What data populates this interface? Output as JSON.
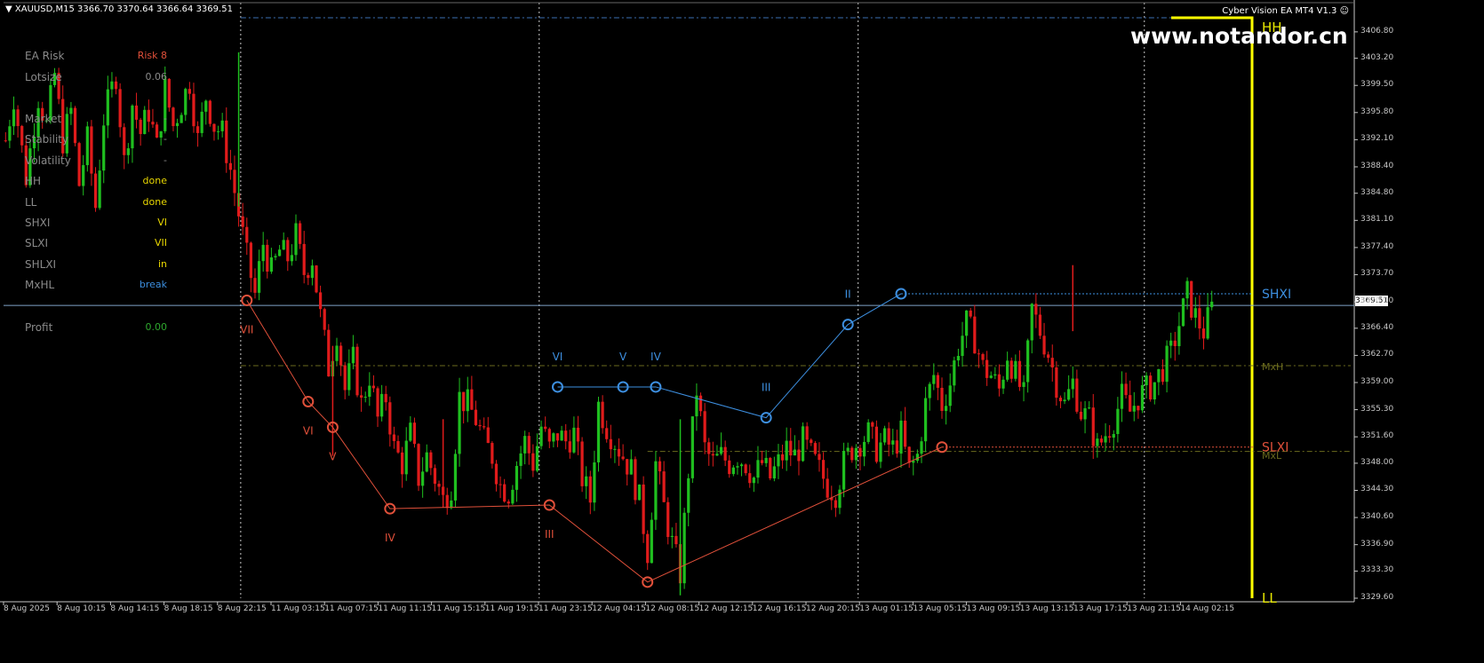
{
  "window": {
    "symbol_header": "XAUUSD,M15  3366.70 3370.64 3366.64 3369.51",
    "ea_title": "Cyber Vision EA MT4 V1.3",
    "watermark": "www.notandor.cn",
    "current_price": "3369.51"
  },
  "info_panel": [
    {
      "label": "EA Risk",
      "value": "Risk 8",
      "color": "#e0503a"
    },
    {
      "label": "Lotsize",
      "value": "0.06",
      "color": "#8a8a8a"
    },
    {
      "label": "Market",
      "value": "-",
      "color": "#8a8a8a"
    },
    {
      "label": "Stability",
      "value": "-",
      "color": "#8a8a8a"
    },
    {
      "label": "Volatility",
      "value": "-",
      "color": "#8a8a8a"
    },
    {
      "label": "HH",
      "value": "done",
      "color": "#e8d600"
    },
    {
      "label": "LL",
      "value": "done",
      "color": "#e8d600"
    },
    {
      "label": "SHXI",
      "value": "VI",
      "color": "#e8d600"
    },
    {
      "label": "SLXI",
      "value": "VII",
      "color": "#e8d600"
    },
    {
      "label": "SHLXI",
      "value": "in",
      "color": "#e8d600"
    },
    {
      "label": "MxHL",
      "value": "break",
      "color": "#3d8fe0"
    },
    {
      "label": "Profit",
      "value": "0.00",
      "color": "#2ea82e"
    }
  ],
  "chart_data": {
    "type": "candlestick",
    "symbol": "XAUUSD",
    "timeframe": "M15",
    "ylim": [
      3329.6,
      3408.6
    ],
    "price_ticks": [
      "3406.80",
      "3403.20",
      "3399.50",
      "3395.80",
      "3392.10",
      "3388.40",
      "3384.80",
      "3381.10",
      "3377.40",
      "3373.70",
      "3370.00",
      "3366.40",
      "3362.70",
      "3359.00",
      "3355.30",
      "3351.60",
      "3348.00",
      "3344.30",
      "3340.60",
      "3336.90",
      "3333.30",
      "3329.60"
    ],
    "time_ticks": [
      "8 Aug 2025",
      "8 Aug 10:15",
      "8 Aug 14:15",
      "8 Aug 18:15",
      "8 Aug 22:15",
      "11 Aug 03:15",
      "11 Aug 07:15",
      "11 Aug 11:15",
      "11 Aug 15:15",
      "11 Aug 19:15",
      "11 Aug 23:15",
      "12 Aug 04:15",
      "12 Aug 08:15",
      "12 Aug 12:15",
      "12 Aug 16:15",
      "12 Aug 20:15",
      "13 Aug 01:15",
      "13 Aug 05:15",
      "13 Aug 09:15",
      "13 Aug 13:15",
      "13 Aug 17:15",
      "13 Aug 21:15",
      "14 Aug 02:15"
    ],
    "price_anchors": [
      [
        0,
        3392
      ],
      [
        2,
        3398
      ],
      [
        5,
        3387
      ],
      [
        8,
        3398
      ],
      [
        10,
        3394
      ],
      [
        12,
        3401
      ],
      [
        14,
        3392
      ],
      [
        16,
        3396
      ],
      [
        18,
        3386
      ],
      [
        20,
        3392
      ],
      [
        22,
        3383
      ],
      [
        24,
        3395
      ],
      [
        27,
        3401
      ],
      [
        29,
        3389
      ],
      [
        31,
        3397
      ],
      [
        33,
        3393
      ],
      [
        35,
        3396
      ],
      [
        37,
        3391
      ],
      [
        39,
        3399
      ],
      [
        41,
        3394
      ],
      [
        43,
        3397
      ],
      [
        45,
        3400
      ],
      [
        47,
        3392
      ],
      [
        49,
        3398
      ],
      [
        51,
        3394
      ],
      [
        53,
        3393
      ],
      [
        55,
        3388
      ],
      [
        57,
        3382
      ],
      [
        59,
        3376
      ],
      [
        61,
        3371
      ],
      [
        63,
        3378
      ],
      [
        65,
        3374
      ],
      [
        67,
        3377
      ],
      [
        69,
        3376
      ],
      [
        71,
        3379
      ],
      [
        73,
        3374
      ],
      [
        75,
        3376
      ],
      [
        77,
        3368
      ],
      [
        79,
        3361
      ],
      [
        81,
        3366
      ],
      [
        83,
        3358
      ],
      [
        85,
        3362
      ],
      [
        87,
        3356
      ],
      [
        89,
        3360
      ],
      [
        91,
        3354
      ],
      [
        93,
        3357
      ],
      [
        95,
        3350
      ],
      [
        97,
        3348
      ],
      [
        99,
        3352
      ],
      [
        101,
        3346
      ],
      [
        103,
        3349
      ],
      [
        105,
        3346
      ],
      [
        107,
        3343
      ],
      [
        109,
        3345
      ],
      [
        111,
        3357
      ],
      [
        113,
        3356
      ],
      [
        115,
        3354
      ],
      [
        117,
        3351
      ],
      [
        119,
        3349
      ],
      [
        121,
        3345
      ],
      [
        123,
        3344
      ],
      [
        125,
        3348
      ],
      [
        127,
        3351
      ],
      [
        129,
        3348
      ],
      [
        131,
        3353
      ],
      [
        133,
        3350
      ],
      [
        135,
        3352
      ],
      [
        137,
        3351
      ],
      [
        139,
        3352
      ],
      [
        141,
        3346
      ],
      [
        143,
        3343
      ],
      [
        145,
        3356
      ],
      [
        147,
        3353
      ],
      [
        149,
        3351
      ],
      [
        151,
        3349
      ],
      [
        153,
        3347
      ],
      [
        155,
        3343
      ],
      [
        157,
        3336
      ],
      [
        159,
        3348
      ],
      [
        161,
        3342
      ],
      [
        163,
        3337
      ],
      [
        165,
        3333
      ],
      [
        167,
        3347
      ],
      [
        169,
        3358
      ],
      [
        171,
        3350
      ],
      [
        173,
        3348
      ],
      [
        175,
        3349
      ],
      [
        177,
        3348
      ],
      [
        179,
        3349
      ],
      [
        181,
        3348
      ],
      [
        183,
        3346
      ],
      [
        185,
        3348
      ],
      [
        187,
        3346
      ],
      [
        189,
        3348
      ],
      [
        191,
        3350
      ],
      [
        193,
        3349
      ],
      [
        195,
        3351
      ],
      [
        197,
        3349
      ],
      [
        199,
        3347
      ],
      [
        201,
        3345
      ],
      [
        203,
        3344
      ],
      [
        205,
        3348
      ],
      [
        207,
        3350
      ],
      [
        209,
        3351
      ],
      [
        211,
        3352
      ],
      [
        213,
        3350
      ],
      [
        215,
        3351
      ],
      [
        217,
        3350
      ],
      [
        219,
        3352
      ],
      [
        221,
        3347
      ],
      [
        223,
        3349
      ],
      [
        225,
        3356
      ],
      [
        227,
        3360
      ],
      [
        229,
        3356
      ],
      [
        231,
        3359
      ],
      [
        233,
        3364
      ],
      [
        235,
        3367
      ],
      [
        237,
        3365
      ],
      [
        239,
        3361
      ],
      [
        241,
        3360
      ],
      [
        243,
        3358
      ],
      [
        245,
        3363
      ],
      [
        247,
        3360
      ],
      [
        249,
        3357
      ],
      [
        251,
        3369
      ],
      [
        253,
        3366
      ],
      [
        255,
        3363
      ],
      [
        257,
        3359
      ],
      [
        259,
        3356
      ],
      [
        261,
        3359
      ],
      [
        263,
        3355
      ],
      [
        265,
        3354
      ],
      [
        267,
        3350
      ],
      [
        269,
        3352
      ],
      [
        271,
        3354
      ],
      [
        273,
        3357
      ],
      [
        275,
        3355
      ],
      [
        277,
        3357
      ],
      [
        279,
        3358
      ],
      [
        281,
        3359
      ],
      [
        283,
        3361
      ],
      [
        285,
        3363
      ],
      [
        287,
        3367
      ],
      [
        289,
        3371
      ],
      [
        291,
        3368
      ],
      [
        293,
        3366
      ],
      [
        295,
        3369
      ]
    ],
    "candle_count": 296,
    "swing_high_points": [
      {
        "label": "VI",
        "bar": 135,
        "price": 3358.4
      },
      {
        "label": "V",
        "bar": 151,
        "price": 3358.4
      },
      {
        "label": "IV",
        "bar": 159,
        "price": 3358.4
      },
      {
        "label": "III",
        "bar": 186,
        "price": 3354.2
      },
      {
        "label": "II",
        "bar": 206,
        "price": 3366.9
      },
      {
        "label": "",
        "bar": 219,
        "price": 3371.1
      }
    ],
    "swing_low_points": [
      {
        "label": "VII",
        "bar": 59,
        "price": 3370.2
      },
      {
        "label": "VI",
        "bar": 74,
        "price": 3356.4
      },
      {
        "label": "V",
        "bar": 80,
        "price": 3352.9
      },
      {
        "label": "IV",
        "bar": 94,
        "price": 3341.8
      },
      {
        "label": "III",
        "bar": 133,
        "price": 3342.3
      },
      {
        "label": "",
        "bar": 157,
        "price": 3331.8
      },
      {
        "label": "",
        "bar": 229,
        "price": 3350.2
      }
    ],
    "levels": [
      {
        "name": "HH",
        "price": 3407.4,
        "color": "#e8e800"
      },
      {
        "name": "SHXI",
        "price": 3371.1,
        "color": "#3d8fe0"
      },
      {
        "name": "MxH",
        "price": 3361.3,
        "color": "#6b6b1e"
      },
      {
        "name": "SLXI",
        "price": 3350.2,
        "color": "#e0503a"
      },
      {
        "name": "MxL",
        "price": 3349.6,
        "color": "#6b6b1e"
      },
      {
        "name": "LL",
        "price": 3329.6,
        "color": "#e8e800"
      }
    ],
    "colors": {
      "bull": "#1fbf1f",
      "bear": "#e01b1b",
      "shxi": "#3d8fe0",
      "slxi": "#e0503a",
      "current_price_line": "#7fa3c8",
      "hh_line": "#ffff00",
      "grid_vertical": "#c8c8c8",
      "dash_top": "#3d6fb5"
    }
  }
}
